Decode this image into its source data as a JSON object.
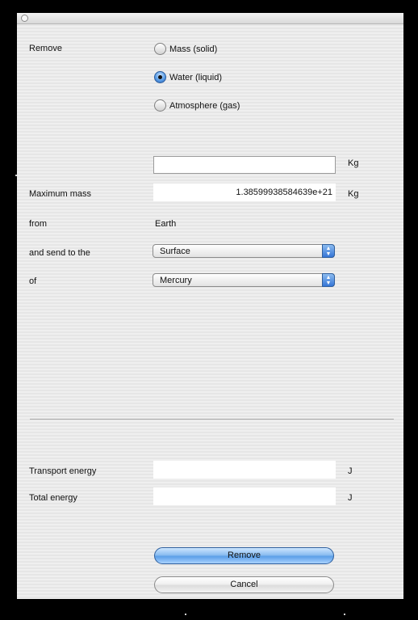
{
  "labels": {
    "remove": "Remove",
    "maximum_mass": "Maximum mass",
    "from": "from",
    "send_to": "and send to the",
    "of": "of",
    "transport_energy": "Transport energy",
    "total_energy": "Total energy"
  },
  "material_options": [
    {
      "label": "Mass (solid)",
      "selected": false
    },
    {
      "label": "Water (liquid)",
      "selected": true
    },
    {
      "label": "Atmosphere (gas)",
      "selected": false
    }
  ],
  "mass_input": {
    "value": "",
    "unit": "Kg"
  },
  "maximum_mass": {
    "value": "1.38599938584639e+21",
    "unit": "Kg"
  },
  "from_body": "Earth",
  "destination_location": {
    "selected": "Surface"
  },
  "destination_body": {
    "selected": "Mercury"
  },
  "transport_energy": {
    "value": "",
    "unit": "J"
  },
  "total_energy": {
    "value": "",
    "unit": "J"
  },
  "buttons": {
    "remove": "Remove",
    "cancel": "Cancel"
  }
}
